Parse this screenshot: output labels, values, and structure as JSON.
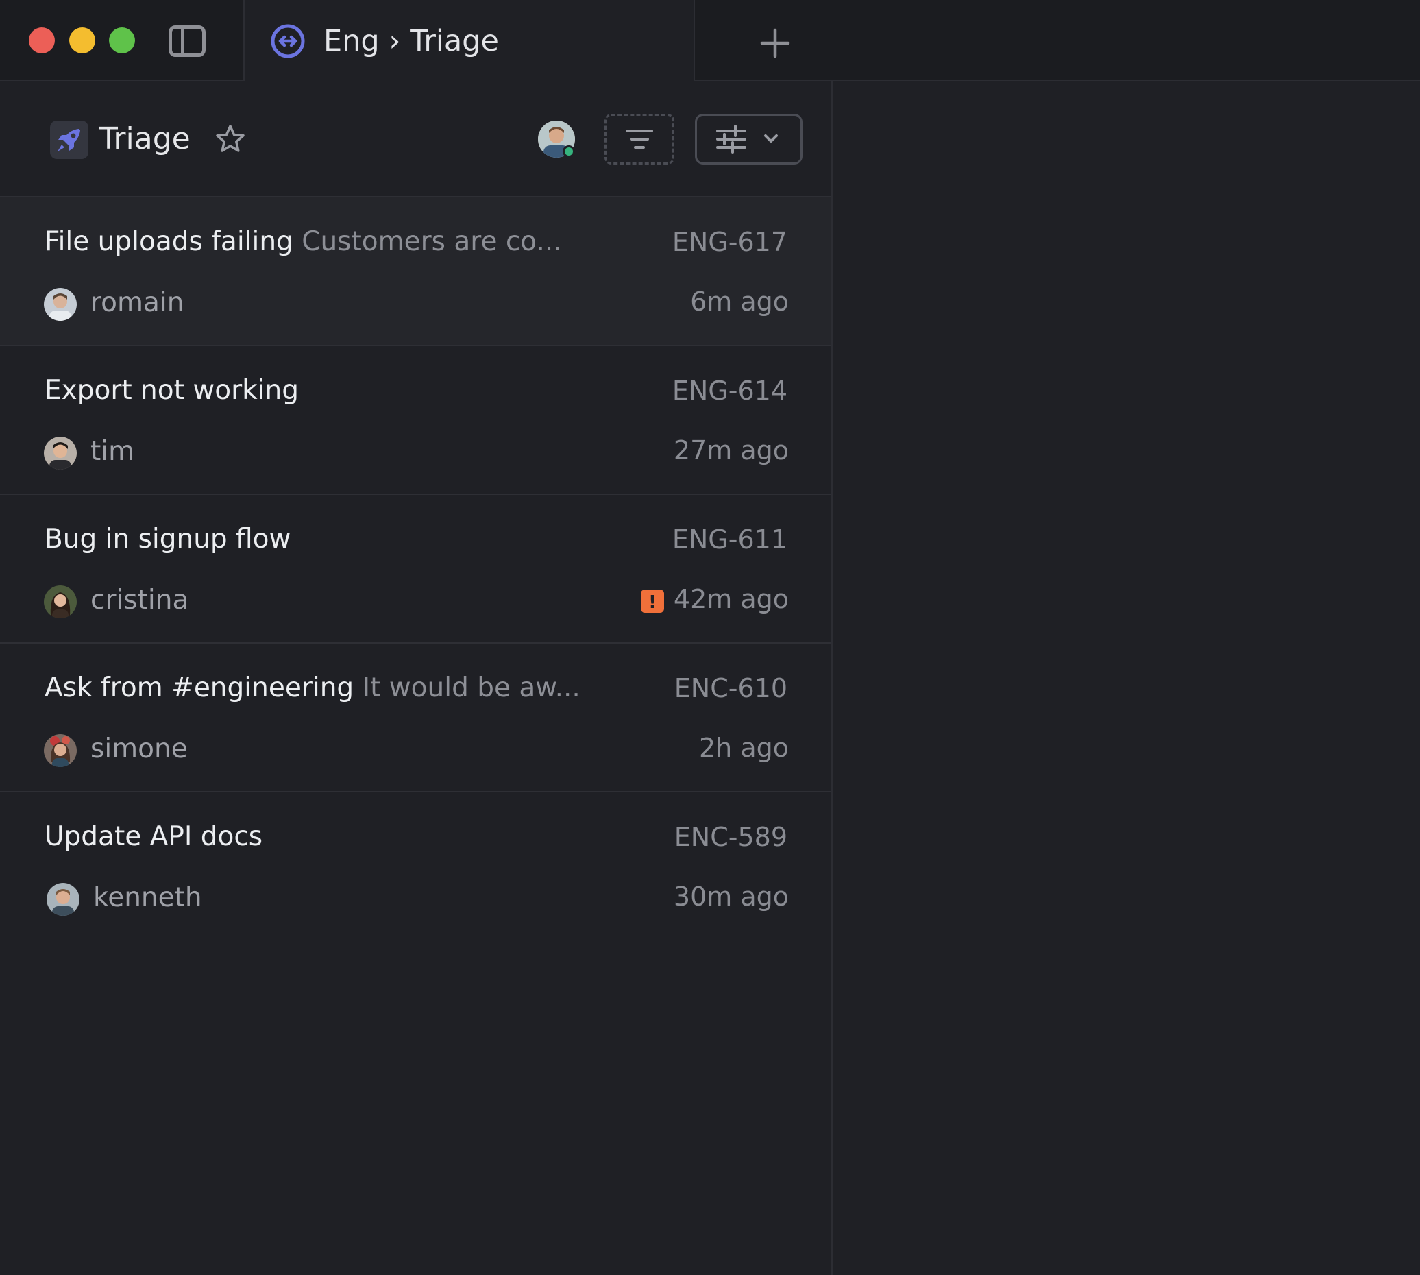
{
  "window": {
    "tab_title": "Eng › Triage",
    "colors": {
      "close": "#ec5f57",
      "minimize": "#f4bd2f",
      "zoom": "#5fc24a",
      "accent": "#5e6ad2",
      "urgent": "#f0703a",
      "online": "#36b37e"
    }
  },
  "header": {
    "title": "Triage",
    "team_icon": "rocket-icon",
    "favorite_icon": "star-icon",
    "filter_icon": "filter-icon",
    "display_icon": "sliders-icon"
  },
  "issues": [
    {
      "title": "File uploads failing",
      "description": "Customers are co...",
      "id": "ENG-617",
      "user": "romain",
      "time": "6m ago",
      "urgent": false,
      "selected": true
    },
    {
      "title": "Export not working",
      "description": "",
      "id": "ENG-614",
      "user": "tim",
      "time": "27m ago",
      "urgent": false,
      "selected": false
    },
    {
      "title": "Bug in signup flow",
      "description": "",
      "id": "ENG-611",
      "user": "cristina",
      "time": "42m ago",
      "urgent": true,
      "selected": false
    },
    {
      "title": "Ask from #engineering",
      "description": "It would be aw...",
      "id": "ENC-610",
      "user": "simone",
      "time": "2h ago",
      "urgent": false,
      "selected": false
    },
    {
      "title": "Update API docs",
      "description": "",
      "id": "ENC-589",
      "user": "kenneth",
      "time": "30m ago",
      "urgent": false,
      "selected": false
    }
  ],
  "urgent_mark": "!"
}
